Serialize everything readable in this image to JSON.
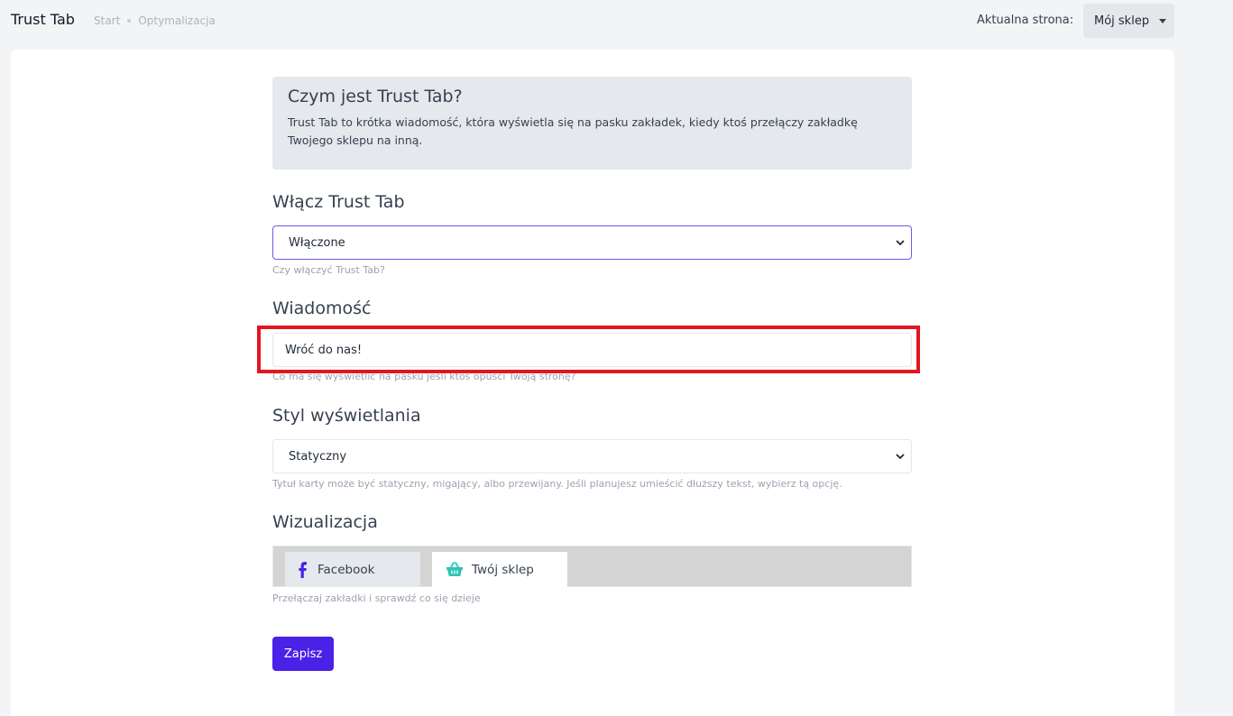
{
  "header": {
    "app_title": "Trust Tab",
    "breadcrumb": [
      "Start",
      "Optymalizacja"
    ],
    "current_page_label": "Aktualna strona:",
    "store_selector": "Mój sklep"
  },
  "info": {
    "title": "Czym jest Trust Tab?",
    "text": "Trust Tab to krótka wiadomość, która wyświetla się na pasku zakładek, kiedy ktoś przełączy zakładkę Twojego sklepu na inną."
  },
  "enable": {
    "title": "Włącz Trust Tab",
    "value": "Włączone",
    "help": "Czy włączyć Trust Tab?"
  },
  "message": {
    "title": "Wiadomość",
    "value": "Wróć do nas!",
    "help": "Co ma się wyświetlić na pasku jeśli ktoś opuści Twoją stronę?"
  },
  "style": {
    "title": "Styl wyświetlania",
    "value": "Statyczny",
    "help": "Tytuł karty może być statyczny, migający, albo przewijany. Jeśli planujesz umieścić dłuższy tekst, wybierz tą opcję."
  },
  "preview": {
    "title": "Wizualizacja",
    "tabs": [
      {
        "label": "Facebook",
        "icon": "facebook-icon"
      },
      {
        "label": "Twój sklep",
        "icon": "basket-icon"
      }
    ],
    "help": "Przełączaj zakładki i sprawdź co się dzieje"
  },
  "save_label": "Zapisz",
  "colors": {
    "accent": "#4921e7",
    "highlight": "#e3151f",
    "facebook": "#4921e7",
    "basket": "#2ec4b6"
  }
}
